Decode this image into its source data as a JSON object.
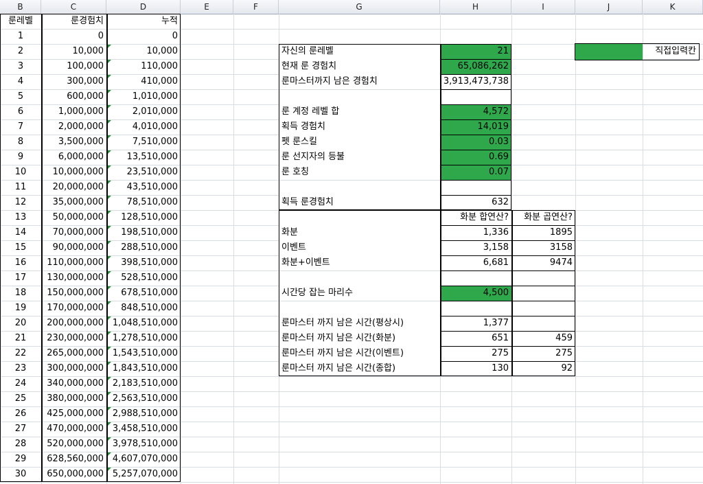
{
  "columns": [
    "B",
    "C",
    "D",
    "E",
    "F",
    "G",
    "H",
    "I",
    "J",
    "K"
  ],
  "table": {
    "headers": [
      "룬레벨",
      "룬경험치",
      "누적"
    ],
    "rows": [
      [
        "1",
        "0",
        "0"
      ],
      [
        "2",
        "10,000",
        "10,000"
      ],
      [
        "3",
        "100,000",
        "110,000"
      ],
      [
        "4",
        "300,000",
        "410,000"
      ],
      [
        "5",
        "600,000",
        "1,010,000"
      ],
      [
        "6",
        "1,000,000",
        "2,010,000"
      ],
      [
        "7",
        "2,000,000",
        "4,010,000"
      ],
      [
        "8",
        "3,500,000",
        "7,510,000"
      ],
      [
        "9",
        "6,000,000",
        "13,510,000"
      ],
      [
        "10",
        "10,000,000",
        "23,510,000"
      ],
      [
        "11",
        "20,000,000",
        "43,510,000"
      ],
      [
        "12",
        "35,000,000",
        "78,510,000"
      ],
      [
        "13",
        "50,000,000",
        "128,510,000"
      ],
      [
        "14",
        "70,000,000",
        "198,510,000"
      ],
      [
        "15",
        "90,000,000",
        "288,510,000"
      ],
      [
        "16",
        "110,000,000",
        "398,510,000"
      ],
      [
        "17",
        "130,000,000",
        "528,510,000"
      ],
      [
        "18",
        "150,000,000",
        "678,510,000"
      ],
      [
        "19",
        "170,000,000",
        "848,510,000"
      ],
      [
        "20",
        "200,000,000",
        "1,048,510,000"
      ],
      [
        "21",
        "230,000,000",
        "1,278,510,000"
      ],
      [
        "22",
        "265,000,000",
        "1,543,510,000"
      ],
      [
        "23",
        "300,000,000",
        "1,843,510,000"
      ],
      [
        "24",
        "340,000,000",
        "2,183,510,000"
      ],
      [
        "25",
        "380,000,000",
        "2,563,510,000"
      ],
      [
        "26",
        "425,000,000",
        "2,988,510,000"
      ],
      [
        "27",
        "470,000,000",
        "3,458,510,000"
      ],
      [
        "28",
        "520,000,000",
        "3,978,510,000"
      ],
      [
        "29",
        "628,560,000",
        "4,607,070,000"
      ],
      [
        "30",
        "650,000,000",
        "5,257,070,000"
      ]
    ]
  },
  "calc": {
    "my_level": {
      "label": "자신의 룬레벨",
      "value": "21"
    },
    "cur_exp": {
      "label": "현재 룬 경험치",
      "value": "65,086,262"
    },
    "remain_exp": {
      "label": "룬마스터까지 남은 경험치",
      "value": "3,913,473,738"
    },
    "level_sum": {
      "label": "룬 계정 레벨 합",
      "value": "4,572"
    },
    "gain_exp": {
      "label": "획득 경험치",
      "value": "14,019"
    },
    "pet_skill": {
      "label": "펫 룬스킬",
      "value": "0.03"
    },
    "pioneer": {
      "label": "룬 선지자의 등불",
      "value": "0.69"
    },
    "title_bonus": {
      "label": "룬 호칭",
      "value": "0.07"
    },
    "gain_rune_exp": {
      "label": "획득 룬경험치",
      "value": "632"
    },
    "col_add": "화분 합연산?",
    "col_mul": "화분 곱연산?",
    "pot": {
      "label": "화분",
      "add": "1,336",
      "mul": "1895"
    },
    "event": {
      "label": "이벤트",
      "add": "3,158",
      "mul": "3158"
    },
    "pot_event": {
      "label": "화분+이벤트",
      "add": "6,681",
      "mul": "9474"
    },
    "kills": {
      "label": "시간당 잡는 마리수",
      "value": "4,500"
    },
    "t_normal": {
      "label": "룬마스터 까지 남은 시간(평상시)",
      "add": "1,377"
    },
    "t_pot": {
      "label": "룬마스터 까지 남은 시간(화분)",
      "add": "651",
      "mul": "459"
    },
    "t_event": {
      "label": "룬마스터 까지 남은 시간(이벤트)",
      "add": "275",
      "mul": "275"
    },
    "t_total": {
      "label": "룬마스터 까지 남은 시간(종합)",
      "add": "130",
      "mul": "92"
    }
  },
  "legend": {
    "label": "직접입력칸"
  },
  "colors": {
    "input_green": "#2ea84a",
    "border": "#000000",
    "note_triangle": "#1d8f35"
  }
}
